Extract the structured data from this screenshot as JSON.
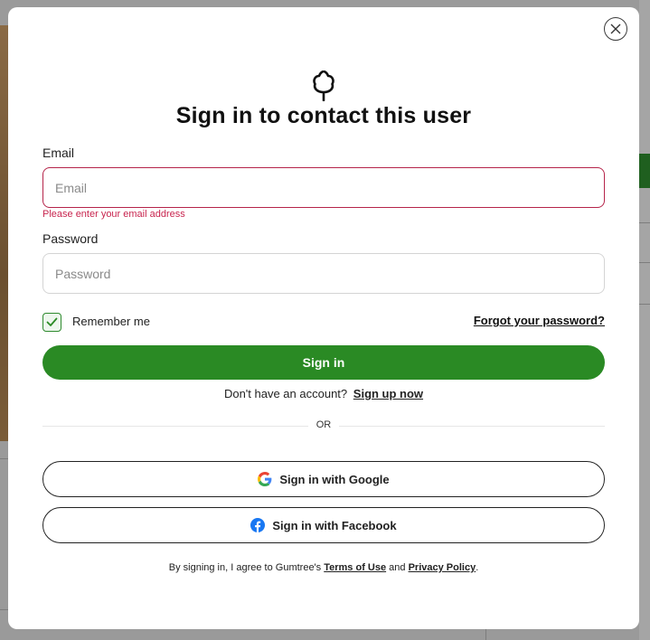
{
  "modal": {
    "title": "Sign in to contact this user",
    "email_label": "Email",
    "email_placeholder": "Email",
    "email_value": "",
    "email_error": "Please enter your email address",
    "password_label": "Password",
    "password_placeholder": "Password",
    "password_value": "",
    "remember_label": "Remember me",
    "remember_checked": true,
    "forgot_link": "Forgot your password?",
    "signin_button": "Sign in",
    "no_account_text": "Don't have an account?",
    "signup_link": "Sign up now",
    "or_text": "OR",
    "google_button": "Sign in with Google",
    "facebook_button": "Sign in with Facebook",
    "terms_prefix": "By signing in, I agree to Gumtree's",
    "terms_link": "Terms of Use",
    "terms_and": "and",
    "privacy_link": "Privacy Policy",
    "terms_suffix": "."
  },
  "icons": {
    "close": "close-icon",
    "logo": "gumtree-tree-icon",
    "check": "checkmark-icon",
    "google": "google-icon",
    "facebook": "facebook-icon"
  },
  "colors": {
    "primary_green": "#2a8a24",
    "error_red": "#c8254f",
    "facebook_blue": "#1877f2"
  }
}
